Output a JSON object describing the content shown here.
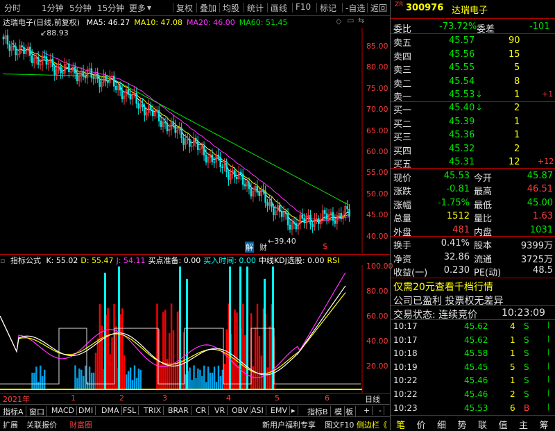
{
  "toolbar": {
    "left_items": [
      "分时",
      "1分钟",
      "5分钟",
      "15分钟",
      "更多"
    ],
    "right_items": [
      "复权",
      "叠加",
      "均股",
      "统计",
      "画线",
      "F10",
      "标记",
      "-自选",
      "返回"
    ]
  },
  "chart": {
    "title": "达瑞电子(日线,前复权)",
    "ma": [
      {
        "label": "MA5: 46.27",
        "color": "#ffffff"
      },
      {
        "label": "MA10: 47.08",
        "color": "#ffff00"
      },
      {
        "label": "MA20: 46.00",
        "color": "#ff33ff"
      },
      {
        "label": "MA60: 51.45",
        "color": "#00e600"
      }
    ],
    "y_ticks": [
      "85.00",
      "80.00",
      "75.00",
      "70.00",
      "65.00",
      "60.00",
      "55.00",
      "50.00",
      "45.00",
      "40.00"
    ],
    "high_label": "88.93",
    "low_label": "39.40",
    "markers": {
      "jie": "解",
      "cai": "财",
      "dollar": "$"
    }
  },
  "indicator": {
    "name": "指标公式",
    "values": [
      {
        "label": "K: 55.02",
        "color": "#ffffff"
      },
      {
        "label": "D: 55.47",
        "color": "#ffff00"
      },
      {
        "label": "J: 54.11",
        "color": "#ff33ff"
      },
      {
        "label": "买点准备: 0.00",
        "color": "#ffffff"
      },
      {
        "label": "买入时间: 0.00",
        "color": "#00ffff"
      },
      {
        "label": "中线KDJ选股: 0.00",
        "color": "#ffffff"
      },
      {
        "label": "RSI",
        "color": "#ffff00"
      }
    ],
    "y_ticks": [
      "100.00",
      "80.00",
      "60.00",
      "40.00",
      "20.00"
    ]
  },
  "xaxis": {
    "labels": [
      "2021年",
      "1",
      "2",
      "3",
      "4",
      "5",
      "6"
    ],
    "right_label": "日线"
  },
  "tabs": [
    "指标A",
    "窗口",
    "MACD",
    "DMI",
    "DMA",
    "FSL",
    "TRIX",
    "BRAR",
    "CR",
    "VR",
    "OBV",
    "ASI",
    "EMV",
    "▸",
    "指标B",
    "模",
    "板",
    "+",
    "-"
  ],
  "bottombar": {
    "left": [
      "扩展",
      "关联报价",
      "财富圈"
    ],
    "right": [
      "新用户福利专享",
      "图文F10",
      "侧边栏《"
    ]
  },
  "quote": {
    "code": "300976",
    "name": "达瑞电子",
    "weibi_label": "委比",
    "weibi": "-73.72%",
    "weicha_label": "委差",
    "weicha": "-101",
    "asks": [
      {
        "label": "卖五",
        "price": "45.57",
        "vol": "90",
        "chg": ""
      },
      {
        "label": "卖四",
        "price": "45.56",
        "vol": "15",
        "chg": ""
      },
      {
        "label": "卖三",
        "price": "45.55",
        "vol": "5",
        "chg": ""
      },
      {
        "label": "卖二",
        "price": "45.54",
        "vol": "8",
        "chg": ""
      },
      {
        "label": "卖一",
        "price": "45.53",
        "vol": "1",
        "chg": "+1"
      }
    ],
    "bids": [
      {
        "label": "买一",
        "price": "45.40",
        "vol": "2",
        "chg": ""
      },
      {
        "label": "买二",
        "price": "45.39",
        "vol": "1",
        "chg": ""
      },
      {
        "label": "买三",
        "price": "45.36",
        "vol": "1",
        "chg": ""
      },
      {
        "label": "买四",
        "price": "45.32",
        "vol": "2",
        "chg": ""
      },
      {
        "label": "买五",
        "price": "45.31",
        "vol": "12",
        "chg": "+12"
      }
    ],
    "stats": [
      {
        "l1": "现价",
        "v1": "45.53",
        "c1": "green",
        "l2": "今开",
        "v2": "45.87",
        "c2": "green"
      },
      {
        "l1": "涨跌",
        "v1": "-0.81",
        "c1": "green",
        "l2": "最高",
        "v2": "46.51",
        "c2": "red"
      },
      {
        "l1": "涨幅",
        "v1": "-1.75%",
        "c1": "green",
        "l2": "最低",
        "v2": "45.00",
        "c2": "green"
      },
      {
        "l1": "总量",
        "v1": "1512",
        "c1": "yellow",
        "l2": "量比",
        "v2": "1.63",
        "c2": "red"
      },
      {
        "l1": "外盘",
        "v1": "481",
        "c1": "red",
        "l2": "内盘",
        "v2": "1031",
        "c2": "green"
      }
    ],
    "stats2": [
      {
        "l1": "换手",
        "v1": "0.41%",
        "l2": "股本",
        "v2": "9399万"
      },
      {
        "l1": "净资",
        "v1": "32.86",
        "l2": "流通",
        "v2": "3725万"
      },
      {
        "l1": "收益(一)",
        "v1": "0.230",
        "l2": "PE(动)",
        "v2": "48.5"
      }
    ],
    "promo": "仅需20元查看千档行情",
    "info": "公司已盈利 投票权无差异",
    "status_label": "交易状态: 连续竞价",
    "status_time": "10:23:09",
    "ticks": [
      {
        "time": "10:17",
        "price": "45.62",
        "vol": "4",
        "side": "S"
      },
      {
        "time": "10:17",
        "price": "45.62",
        "vol": "1",
        "side": "S"
      },
      {
        "time": "10:18",
        "price": "45.58",
        "vol": "1",
        "side": "S"
      },
      {
        "time": "10:19",
        "price": "45.45",
        "vol": "5",
        "side": "S"
      },
      {
        "time": "10:22",
        "price": "45.46",
        "vol": "1",
        "side": "S"
      },
      {
        "time": "10:22",
        "price": "45.46",
        "vol": "2",
        "side": "S"
      },
      {
        "time": "10:23",
        "price": "45.53",
        "vol": "6",
        "side": "B"
      }
    ],
    "footer": [
      "笔",
      "价",
      "细",
      "势",
      "联",
      "值",
      "主",
      "筹"
    ]
  }
}
